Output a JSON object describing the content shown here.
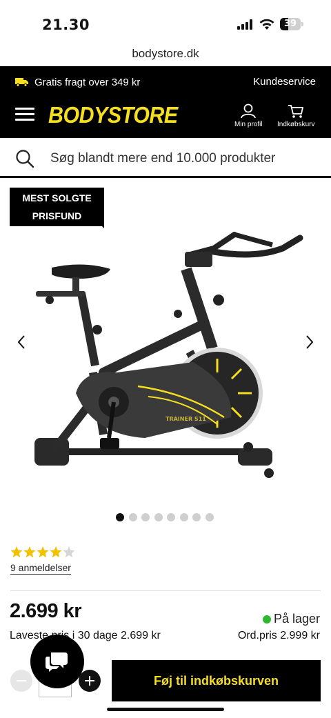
{
  "status_bar": {
    "time": "21.30",
    "battery": "39",
    "battery_level": 0.39
  },
  "browser": {
    "url": "bodystore.dk"
  },
  "header": {
    "promo_text": "Gratis fragt over 349 kr",
    "service_link": "Kundeservice",
    "logo": "BODYSTORE",
    "profile_label": "Min profil",
    "cart_label": "Indkøbskurv"
  },
  "search": {
    "placeholder": "Søg blandt mere end 10.000 produkter"
  },
  "product": {
    "badge_line1": "MEST SOLGTE",
    "badge_line2": "PRISFUND",
    "gallery_count": 8,
    "gallery_active": 0,
    "rating": 4,
    "rating_max": 5,
    "reviews_link": "9 anmeldelser",
    "price": "2.699 kr",
    "lowest_price": "Laveste pris i 30 dage 2.699 kr",
    "stock": "På lager",
    "ord_price": "Ord.pris 2.999 kr",
    "quantity": "",
    "add_to_cart": "Føj til indkøbskurven"
  },
  "colors": {
    "brand_yellow": "#f6df1f",
    "stock_green": "#2eb82e",
    "black": "#000000"
  }
}
